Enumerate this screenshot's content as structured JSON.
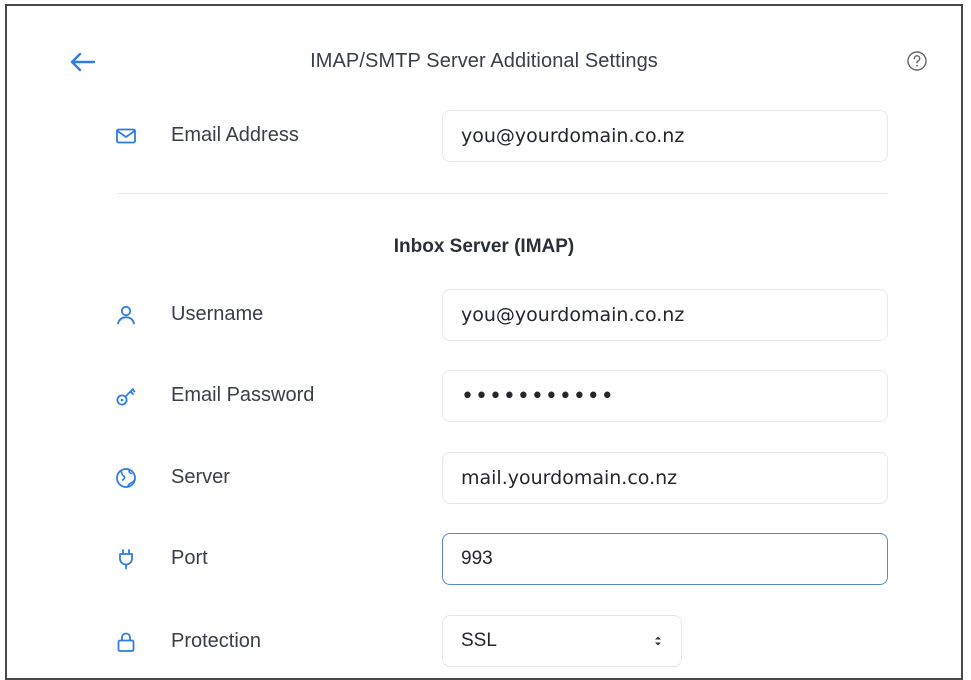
{
  "header": {
    "title": "IMAP/SMTP Server Additional Settings",
    "back_icon": "arrow-left-icon",
    "help_icon": "question-circle-icon"
  },
  "email": {
    "label": "Email Address",
    "icon": "envelope-icon",
    "value": "you@yourdomain.co.nz"
  },
  "inbox": {
    "title": "Inbox Server (IMAP)",
    "username": {
      "label": "Username",
      "icon": "user-icon",
      "value": "you@yourdomain.co.nz"
    },
    "password": {
      "label": "Email Password",
      "icon": "key-icon",
      "value": "•••••••••••"
    },
    "server": {
      "label": "Server",
      "icon": "globe-icon",
      "value": "mail.yourdomain.co.nz"
    },
    "port": {
      "label": "Port",
      "icon": "plug-icon",
      "value": "993"
    },
    "protection": {
      "label": "Protection",
      "icon": "lock-icon",
      "value": "SSL",
      "options": [
        "SSL"
      ]
    }
  },
  "colors": {
    "accent": "#2f7de1",
    "focus_border": "#5f88c3",
    "field_border": "#e6e8ec"
  }
}
